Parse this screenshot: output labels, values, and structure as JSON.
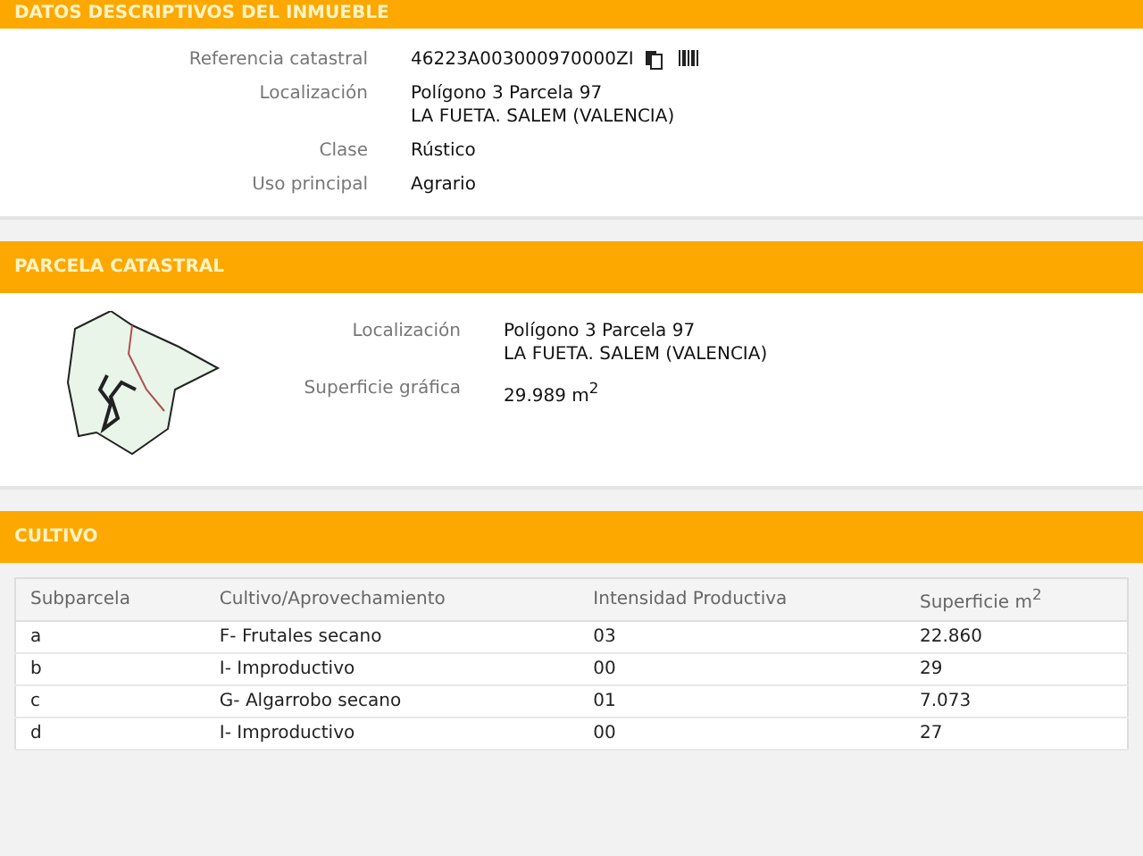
{
  "sections": [
    {
      "title": "DATOS DESCRIPTIVOS DEL INMUEBLE",
      "kind": "fields",
      "fields": [
        {
          "label": "Referencia catastral",
          "lines": [
            "46223A003000970000ZI"
          ],
          "tools": true
        },
        {
          "label": "Localización",
          "lines": [
            "Polígono 3 Parcela 97",
            "LA FUETA. SALEM (VALENCIA)"
          ]
        },
        {
          "label": "Clase",
          "lines": [
            "Rústico"
          ]
        },
        {
          "label": "Uso principal",
          "lines": [
            "Agrario"
          ]
        }
      ]
    },
    {
      "title": "PARCELA CATASTRAL",
      "kind": "parcel",
      "fields": [
        {
          "label": "Localización",
          "lines": [
            "Polígono 3 Parcela 97",
            "LA FUETA. SALEM (VALENCIA)"
          ]
        },
        {
          "label": "Superficie gráfica",
          "lines": [
            "29.989 m$^{2}$"
          ]
        }
      ]
    },
    {
      "title": "CULTIVO",
      "kind": "table",
      "columns": [
        "Subparcela",
        "Cultivo/Aprovechamiento",
        "Intensidad Productiva",
        "Superficie m$^{2}$"
      ],
      "rows": [
        [
          "a",
          "F- Frutales secano",
          "03",
          "22.860"
        ],
        [
          "b",
          "I- Improductivo",
          "00",
          "29"
        ],
        [
          "c",
          "G- Algarrobo secano",
          "01",
          "7.073"
        ],
        [
          "d",
          "I- Improductivo",
          "00",
          "27"
        ]
      ]
    }
  ]
}
